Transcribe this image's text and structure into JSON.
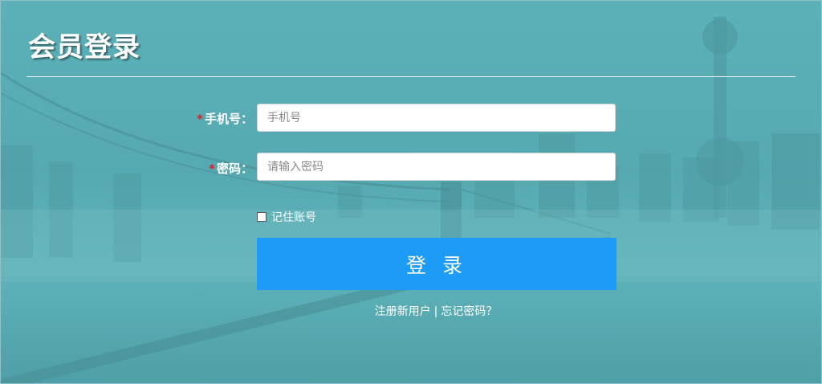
{
  "header": {
    "title": "会员登录"
  },
  "form": {
    "phone": {
      "required_mark": "*",
      "label": "手机号：",
      "placeholder": "手机号"
    },
    "password": {
      "required_mark": "*",
      "label": "密码：",
      "placeholder": "请输入密码"
    },
    "remember_label": "记住账号",
    "remember_checked": false,
    "submit_label": "登 录"
  },
  "footer_links": {
    "register": "注册新用户",
    "separator": "|",
    "forgot": "忘记密码？"
  },
  "colors": {
    "background_tint": "#58abb3",
    "button": "#1e9bf7",
    "required_mark": "#d8232a"
  }
}
